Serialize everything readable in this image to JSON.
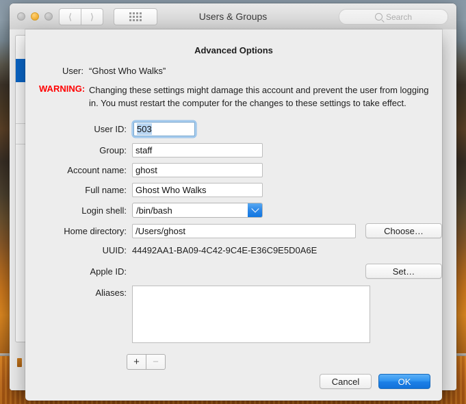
{
  "window": {
    "title": "Users & Groups",
    "traffic_lights": [
      {
        "name": "close",
        "state": "inactive"
      },
      {
        "name": "minimize",
        "state": "active-amber"
      },
      {
        "name": "zoom",
        "state": "inactive"
      }
    ],
    "nav_back_icon": "chevron-left-icon",
    "nav_forward_icon": "chevron-right-icon",
    "grid_icon": "grid-dots-icon",
    "search": {
      "icon": "search-icon",
      "placeholder": "Search"
    }
  },
  "sheet": {
    "title": "Advanced Options",
    "user_label": "User:",
    "user_value": "“Ghost Who Walks”",
    "warning_label": "WARNING:",
    "warning_text": "Changing these settings might damage this account and prevent the user from logging in. You must restart the computer for the changes to these settings to take effect.",
    "warning_color": "#ff0000",
    "fields": {
      "user_id_label": "User ID:",
      "user_id_value": "503",
      "group_label": "Group:",
      "group_value": "staff",
      "account_name_label": "Account name:",
      "account_name_value": "ghost",
      "full_name_label": "Full name:",
      "full_name_value": "Ghost Who Walks",
      "login_shell_label": "Login shell:",
      "login_shell_value": "/bin/bash",
      "login_shell_arrow_icon": "chevron-down-icon",
      "home_directory_label": "Home directory:",
      "home_directory_value": "/Users/ghost",
      "choose_button": "Choose…",
      "uuid_label": "UUID:",
      "uuid_value": "44492AA1-BA09-4C42-9C4E-E36C9E5D0A6E",
      "apple_id_label": "Apple ID:",
      "apple_id_value": "",
      "set_button": "Set…",
      "aliases_label": "Aliases:",
      "aliases_rows": [
        "",
        "",
        "",
        ""
      ],
      "add_alias_icon": "plus-icon",
      "remove_alias_icon": "minus-icon"
    },
    "footer": {
      "cancel_label": "Cancel",
      "ok_label": "OK",
      "ok_accent": "#1d80e8"
    }
  },
  "desktop": {
    "selection_accent": "#0a66c8"
  }
}
